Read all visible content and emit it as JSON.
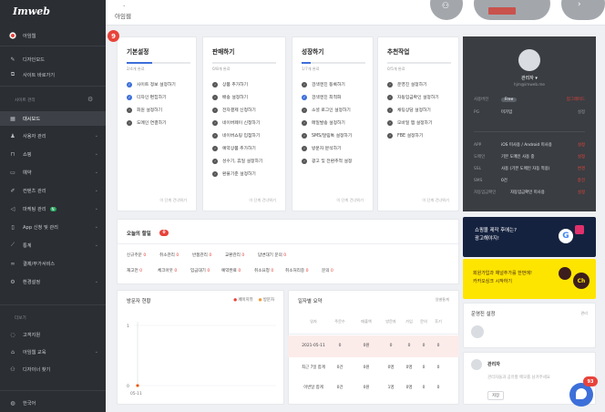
{
  "app": {
    "logo": "Imweb",
    "breadcrumb": "아임웹"
  },
  "sidebar": {
    "top_items": [
      {
        "label": "아임웹"
      },
      {
        "label": "디자인모드"
      },
      {
        "label": "사이트 바로가기"
      }
    ],
    "section_site": "사이트 관리",
    "items": [
      {
        "label": "대시보드"
      },
      {
        "label": "사용자 관리"
      },
      {
        "label": "쇼핑"
      },
      {
        "label": "예약"
      },
      {
        "label": "컨텐츠 관리"
      },
      {
        "label": "마케팅 관리",
        "badge": "N"
      },
      {
        "label": "App 신청 및 관리"
      },
      {
        "label": "통계"
      },
      {
        "label": "결제/부가서비스"
      },
      {
        "label": "환경설정"
      }
    ],
    "section_more": "더보기",
    "more_items": [
      {
        "label": "고객지원"
      },
      {
        "label": "아임웹 교육"
      },
      {
        "label": "디자이너 찾기"
      }
    ],
    "language": "한국어"
  },
  "onboarding": {
    "count_badge": "9",
    "columns": [
      {
        "title": "기본설정",
        "progress": 0.4,
        "sub": "2/4개 완료",
        "tasks": [
          {
            "label": "사이트 정보 설정하기",
            "done": true
          },
          {
            "label": "디자인 편집하기",
            "done": true
          },
          {
            "label": "회원 설정하기",
            "done": false
          },
          {
            "label": "도메인 연결하기",
            "done": false
          }
        ],
        "next": "이 단계 건너뛰기"
      },
      {
        "title": "판매하기",
        "progress": 0.0,
        "sub": "0/8개 완료",
        "tasks": [
          {
            "label": "상품 추가하기",
            "done": false
          },
          {
            "label": "배송 설정하기",
            "done": false
          },
          {
            "label": "전자결제 신청하기",
            "done": false
          },
          {
            "label": "네이버페이 신청하기",
            "done": false
          },
          {
            "label": "네이버쇼핑 입점하기",
            "done": false
          },
          {
            "label": "예약상품 추가하기",
            "done": false
          },
          {
            "label": "성수기, 휴일 설정하기",
            "done": false
          },
          {
            "label": "환불기준 설정하기",
            "done": false
          }
        ],
        "next": "이 단계 건너뛰기"
      },
      {
        "title": "성장하기",
        "progress": 0.14,
        "sub": "1/7개 완료",
        "tasks": [
          {
            "label": "검색엔진 등록하기",
            "done": false
          },
          {
            "label": "검색엔진 최적화",
            "done": true
          },
          {
            "label": "소셜 로그인 설정하기",
            "done": false
          },
          {
            "label": "메일발송 설정하기",
            "done": false
          },
          {
            "label": "SMS/알림톡 설정하기",
            "done": false
          },
          {
            "label": "방문자 분석하기",
            "done": false
          },
          {
            "label": "광고 및 전환추적 설정",
            "done": false
          }
        ],
        "next": "이 단계 건너뛰기"
      },
      {
        "title": "추천작업",
        "progress": 0.0,
        "sub": "0/5개 완료",
        "tasks": [
          {
            "label": "운영진 설정하기",
            "done": false
          },
          {
            "label": "자동입금확인 설정하기",
            "done": false
          },
          {
            "label": "채팅상담 설정하기",
            "done": false
          },
          {
            "label": "모바일 앱 설정하기",
            "done": false
          },
          {
            "label": "FBE 설정하기",
            "done": false
          }
        ],
        "next": "이 단계 건너뛰기"
      }
    ]
  },
  "account": {
    "name": "관리자",
    "email": "hjm@imweb.me",
    "rows": [
      {
        "k": "사용버전",
        "v": "Free",
        "s": "업그레이드"
      },
      {
        "k": "PG",
        "v": "미가입",
        "s": "설정"
      }
    ],
    "rows2": [
      {
        "k": "APP",
        "v": "iOS 미사용 / Android 미사용",
        "s": "설정"
      },
      {
        "k": "도메인",
        "v": "기본 도메인 사용 중",
        "s": "설정"
      },
      {
        "k": "SSL",
        "v": "사용 (기본 도메인 자동 적용)",
        "s": "변경"
      },
      {
        "k": "SMS",
        "v": "0건",
        "s": "충전"
      },
      {
        "k": "자동입금확인",
        "v": "자동입금확인 미사용",
        "s": "설정"
      }
    ]
  },
  "today": {
    "title": "오늘의 할일",
    "badge": "0",
    "row1": [
      {
        "label": "신규주문",
        "value": "0"
      },
      {
        "label": "취소관리",
        "value": "0"
      },
      {
        "label": "반품관리",
        "value": "0"
      },
      {
        "label": "교환관리",
        "value": "0"
      },
      {
        "label": "답변대기 문의",
        "value": "0"
      }
    ],
    "row2": [
      {
        "label": "재고먼",
        "value": "0"
      },
      {
        "label": "체크아웃",
        "value": "0"
      },
      {
        "label": "입금대기",
        "value": "0"
      },
      {
        "label": "예약완료",
        "value": "0"
      },
      {
        "label": "취소요청",
        "value": "0"
      },
      {
        "label": "취소처리중",
        "value": "0"
      },
      {
        "label": "문의",
        "value": "0"
      }
    ]
  },
  "visitors": {
    "title": "방문자 현황",
    "legend_pv": "페이지뷰",
    "legend_uv": "방문자",
    "color_pv": "#e8433a",
    "color_uv": "#f29a3a",
    "y_labels": [
      "1",
      "0"
    ],
    "x_label": "05-11",
    "y_value": 0
  },
  "daily": {
    "title": "일자별 요약",
    "link": "일별통계",
    "headers": [
      "일자",
      "주문수",
      "매출액",
      "방문자",
      "가입",
      "문의",
      "후기"
    ],
    "rows": [
      [
        "2021-05-11",
        "0",
        "0원",
        "0",
        "0",
        "0",
        "0"
      ],
      [
        "최근 7일 합계",
        "0건",
        "0원",
        "0명",
        "0명",
        "0",
        "0"
      ],
      [
        "이번달 합계",
        "0건",
        "0원",
        "1명",
        "0명",
        "0",
        "0"
      ]
    ]
  },
  "promo1": {
    "line1": "쇼핑몰 제작 후에는?",
    "line2": "광고해야지!"
  },
  "promo2": {
    "line1": "회원가입과 채널추가를 한번에!",
    "line2": "카카오싱크 시작하기"
  },
  "operators": {
    "title": "운영진 설정",
    "link": "관리"
  },
  "memo": {
    "name": "관리자",
    "text": "관리자들과 공유할 메모를 남겨주세요",
    "save": "저장"
  },
  "chat_badge": "93"
}
